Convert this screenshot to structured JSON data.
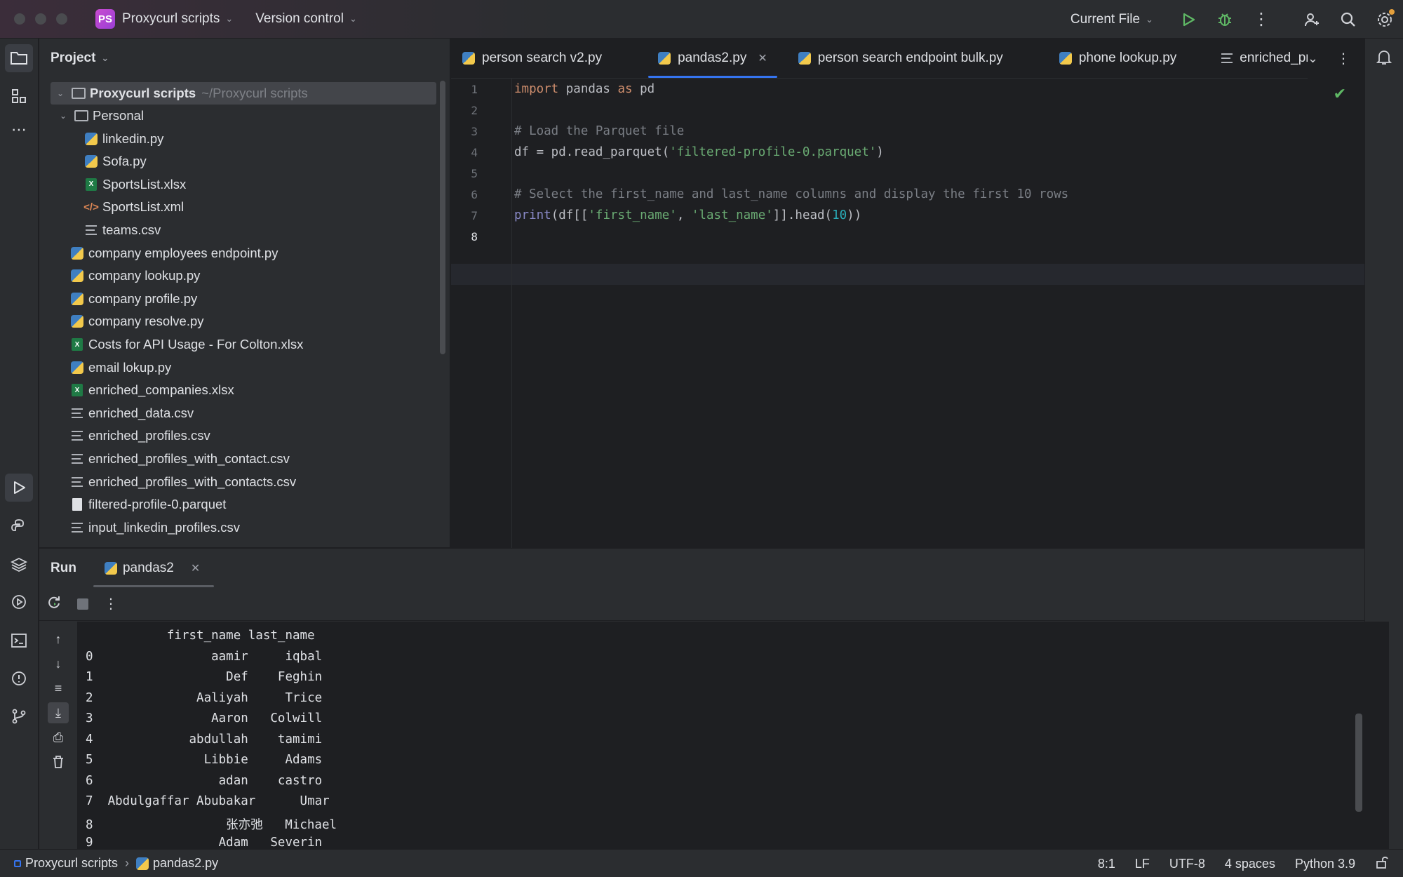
{
  "titlebar": {
    "project_badge": "PS",
    "project_name": "Proxycurl scripts",
    "version_control": "Version control",
    "run_config": "Current File"
  },
  "project_panel": {
    "title": "Project",
    "root": {
      "name": "Proxycurl scripts",
      "path": "~/Proxycurl scripts"
    },
    "items": [
      {
        "name": "Personal",
        "type": "folder"
      },
      {
        "name": "linkedin.py",
        "type": "python"
      },
      {
        "name": "Sofa.py",
        "type": "python"
      },
      {
        "name": "SportsList.xlsx",
        "type": "excel"
      },
      {
        "name": "SportsList.xml",
        "type": "xml"
      },
      {
        "name": "teams.csv",
        "type": "text"
      },
      {
        "name": "company employees endpoint.py",
        "type": "python"
      },
      {
        "name": "company lookup.py",
        "type": "python"
      },
      {
        "name": "company profile.py",
        "type": "python"
      },
      {
        "name": "company resolve.py",
        "type": "python"
      },
      {
        "name": "Costs for API Usage - For Colton.xlsx",
        "type": "excel"
      },
      {
        "name": "email lokup.py",
        "type": "python"
      },
      {
        "name": "enriched_companies.xlsx",
        "type": "excel"
      },
      {
        "name": "enriched_data.csv",
        "type": "text"
      },
      {
        "name": "enriched_profiles.csv",
        "type": "text"
      },
      {
        "name": "enriched_profiles_with_contact.csv",
        "type": "text"
      },
      {
        "name": "enriched_profiles_with_contacts.csv",
        "type": "text"
      },
      {
        "name": "filtered-profile-0.parquet",
        "type": "file"
      },
      {
        "name": "input_linkedin_profiles.csv",
        "type": "text"
      }
    ]
  },
  "editor": {
    "tabs": [
      {
        "label": "person search v2.py",
        "icon": "python",
        "active": false
      },
      {
        "label": "pandas2.py",
        "icon": "python",
        "active": true
      },
      {
        "label": "person search endpoint bulk.py",
        "icon": "python",
        "active": false
      },
      {
        "label": "phone lookup.py",
        "icon": "python",
        "active": false
      },
      {
        "label": "enriched_profiles_",
        "icon": "text",
        "active": false
      }
    ],
    "line_numbers": [
      "1",
      "2",
      "3",
      "4",
      "5",
      "6",
      "7",
      "8"
    ],
    "code": {
      "l1": {
        "kw1": "import",
        "mod": " pandas ",
        "kw2": "as",
        "alias": " pd"
      },
      "l3": "# Load the Parquet file",
      "l4": {
        "pre": "df = pd.read_parquet(",
        "str": "'filtered-profile-0.parquet'",
        "post": ")"
      },
      "l6": "# Select the first_name and last_name columns and display the first 10 rows",
      "l7": {
        "fn": "print",
        "a": "(df[[",
        "s1": "'first_name'",
        "b": ", ",
        "s2": "'last_name'",
        "c": "]].head(",
        "n": "10",
        "d": "))"
      }
    }
  },
  "run_panel": {
    "title": "Run",
    "tab_label": "pandas2",
    "output_lines": [
      "           first_name last_name",
      "0                aamir     iqbal",
      "1                  Def    Feghin",
      "2              Aaliyah     Trice",
      "3                Aaron   Colwill",
      "4             abdullah    tamimi",
      "5               Libbie     Adams",
      "6                 adan    castro",
      "7  Abdulgaffar Abubakar      Umar",
      "8                  张亦弛   Michael",
      "9                 Adam   Severin"
    ]
  },
  "statusbar": {
    "breadcrumb_project": "Proxycurl scripts",
    "breadcrumb_file": "pandas2.py",
    "position": "8:1",
    "line_ending": "LF",
    "encoding": "UTF-8",
    "indent": "4 spaces",
    "interpreter": "Python 3.9"
  },
  "colors": {
    "accent": "#3574f0",
    "run_green": "#5fb865",
    "keyword": "#cf8e6d",
    "string": "#6aab73",
    "comment": "#7a7e85"
  }
}
